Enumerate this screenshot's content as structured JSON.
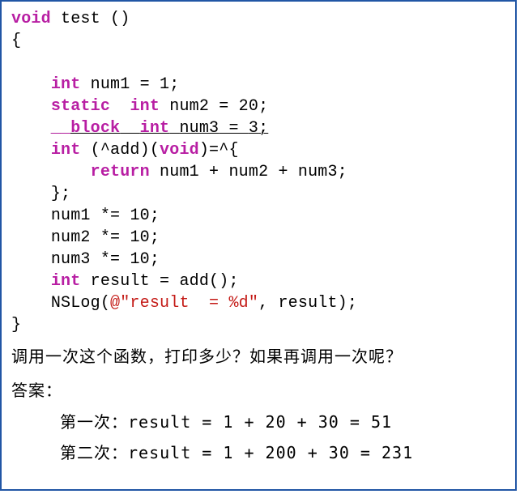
{
  "code": {
    "kw_void": "void",
    "fn_name": "test ()",
    "open_brace": "{",
    "indent1": "    ",
    "indent2": "        ",
    "kw_int": "int",
    "kw_static": "static",
    "kw_block": "__block",
    "num1_name": "num1",
    "num2_name": "num2",
    "num3_name": "num3",
    "eq": " = ",
    "num1_val": "1",
    "num2_val": "20",
    "num3_val": "3",
    "semi": ";",
    "add_decl_open": " (^add)(",
    "kw_void2": "void",
    "add_decl_close": ")=^{",
    "kw_return": "return",
    "return_expr": " num1 + num2 + num3;",
    "block_close": "};",
    "mul1": "num1 *= ",
    "mul2": "num2 *= ",
    "mul3": "num3 *= ",
    "ten": "10",
    "result_decl": " result = add();",
    "nslog_fn": "NSLog",
    "nslog_open": "(",
    "nslog_at": "@\"result  = %d\"",
    "nslog_close": ", result);",
    "close_brace": "}"
  },
  "question": {
    "line": "调用一次这个函数，打印多少？如果再调用一次呢？",
    "answer_label": "答案：",
    "a1_label": "第一次：",
    "a1_expr": "result = 1 + 20 + 30 = 51",
    "a2_label": "第二次：",
    "a2_expr": "result = 1 + 200 + 30 = 231"
  }
}
